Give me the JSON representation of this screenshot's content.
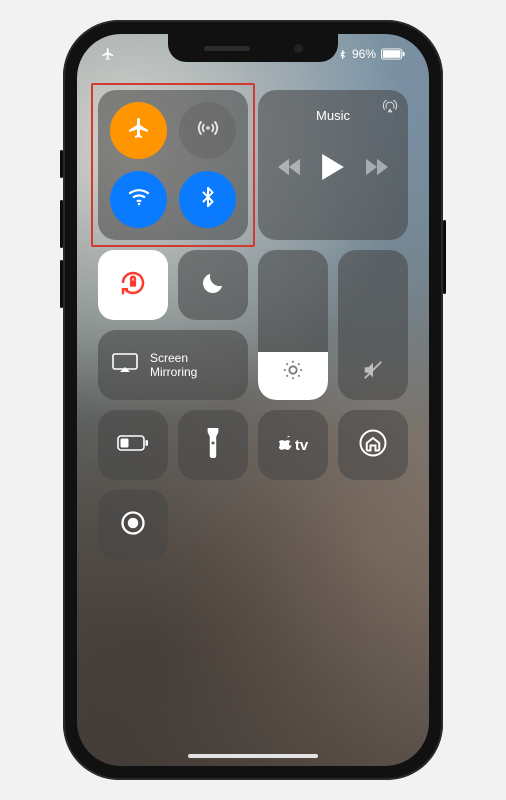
{
  "status": {
    "battery_text": "96%"
  },
  "connectivity": {
    "airplane_on": true,
    "cellular_on": false,
    "wifi_on": true,
    "bluetooth_on": true
  },
  "media": {
    "title": "Music"
  },
  "screen_mirroring": {
    "label": "Screen\nMirroring"
  },
  "sliders": {
    "brightness_pct": 32,
    "volume_pct": 0
  },
  "colors": {
    "orange": "#ff9500",
    "blue": "#0a7aff",
    "red": "#ff3b30",
    "highlight": "#d33a2f"
  }
}
